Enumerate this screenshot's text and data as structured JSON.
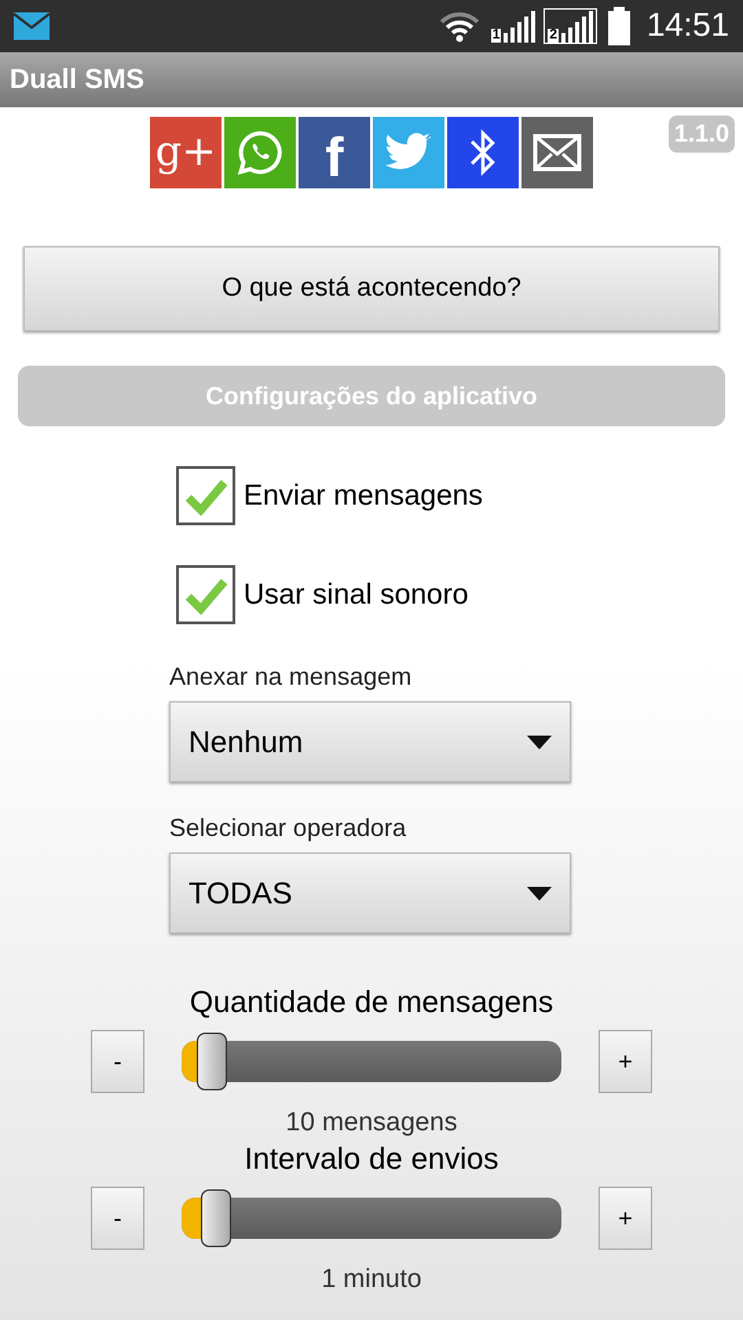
{
  "status_bar": {
    "time": "14:51",
    "sims": [
      "1",
      "2"
    ]
  },
  "app_bar": {
    "title": "Duall SMS"
  },
  "share_buttons": [
    {
      "kind": "gplus",
      "label": "g+",
      "color": "#d34836"
    },
    {
      "kind": "whatsapp",
      "color": "#4caf1a"
    },
    {
      "kind": "facebook",
      "label": "f",
      "color": "#3b5998"
    },
    {
      "kind": "twitter",
      "color": "#33aee8"
    },
    {
      "kind": "bluetooth",
      "color": "#2346ea"
    },
    {
      "kind": "email",
      "color": "#626262"
    }
  ],
  "version": "1.1.0",
  "main_button": "O que está acontecendo?",
  "section_header": "Configurações do aplicativo",
  "checkboxes": [
    {
      "label": "Enviar mensagens",
      "checked": true
    },
    {
      "label": "Usar sinal sonoro",
      "checked": true
    }
  ],
  "dropdowns": [
    {
      "label": "Anexar na mensagem",
      "value": "Nenhum"
    },
    {
      "label": "Selecionar operadora",
      "value": "TODAS"
    }
  ],
  "sliders": [
    {
      "title": "Quantidade de mensagens",
      "minus": "-",
      "plus": "+",
      "level": 0.02,
      "reading": "10 mensagens"
    },
    {
      "title": "Intervalo de envios",
      "minus": "-",
      "plus": "+",
      "level": 0.03,
      "reading": "1 minuto"
    }
  ]
}
